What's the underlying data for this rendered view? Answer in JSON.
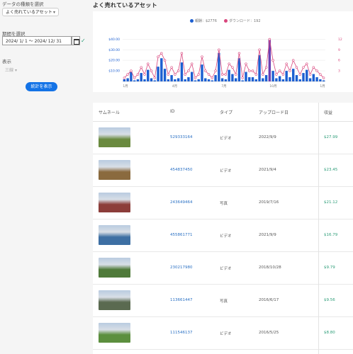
{
  "sidebar": {
    "data_type_label": "データの種類を選択",
    "data_type_value": "よく売れているアセット",
    "period_label": "期間を選択",
    "date_range": "2024/ 1/ 1 ～ 2024/ 12/ 31",
    "display_label": "表示",
    "display_value": "三線",
    "stats_button": "統計を表示"
  },
  "page_title": "よく売れているアセット",
  "chart_data": {
    "type": "bar+line",
    "legend": [
      {
        "name": "報酬：$2776",
        "color": "#1c5fd1"
      },
      {
        "name": "ダウンロード：192",
        "color": "#d9467d"
      }
    ],
    "y_left_ticks": [
      "$40.00",
      "$30.00",
      "$20.00",
      "$10.00"
    ],
    "y_right_ticks": [
      "12",
      "9",
      "6",
      "3"
    ],
    "x_ticks": [
      "1月",
      "4月",
      "7月",
      "10月",
      "1月"
    ],
    "earnings": [
      2,
      3,
      9,
      1,
      2,
      8,
      2,
      11,
      3,
      1,
      14,
      22,
      12,
      2,
      6,
      2,
      3,
      18,
      2,
      4,
      9,
      1,
      2,
      16,
      3,
      2,
      1,
      6,
      27,
      3,
      2,
      11,
      7,
      3,
      22,
      1,
      9,
      4,
      4,
      2,
      25,
      3,
      6,
      40,
      10,
      3,
      5,
      2,
      10,
      4,
      12,
      6,
      2,
      8,
      11,
      3,
      7,
      4,
      2,
      1
    ],
    "downloads": [
      1,
      2,
      3,
      1,
      2,
      4,
      2,
      5,
      3,
      1,
      7,
      8,
      6,
      2,
      4,
      2,
      3,
      8,
      2,
      3,
      5,
      1,
      2,
      7,
      3,
      2,
      1,
      3,
      9,
      2,
      2,
      5,
      4,
      2,
      8,
      1,
      5,
      3,
      3,
      2,
      9,
      2,
      4,
      12,
      6,
      2,
      3,
      2,
      5,
      3,
      6,
      4,
      2,
      4,
      5,
      2,
      4,
      3,
      2,
      1
    ],
    "ylim_left": [
      0,
      45
    ],
    "ylim_right": [
      0,
      13.5
    ]
  },
  "table": {
    "columns": [
      "サムネール",
      "ID",
      "タイプ",
      "アップロード日",
      "収益"
    ],
    "rows": [
      {
        "id": "529333164",
        "type": "ビデオ",
        "date": "2022/9/9",
        "earning": "$27.99",
        "thumb_color": "#6a8a3f"
      },
      {
        "id": "454837450",
        "type": "ビデオ",
        "date": "2021/9/4",
        "earning": "$23.45",
        "thumb_color": "#8a6a3e"
      },
      {
        "id": "243649464",
        "type": "写真",
        "date": "2019/7/16",
        "earning": "$21.12",
        "thumb_color": "#8c3d3a"
      },
      {
        "id": "455861771",
        "type": "ビデオ",
        "date": "2021/9/9",
        "earning": "$16.79",
        "thumb_color": "#3d6fa3"
      },
      {
        "id": "230217980",
        "type": "ビデオ",
        "date": "2018/10/28",
        "earning": "$9.79",
        "thumb_color": "#4f7a3a"
      },
      {
        "id": "113661447",
        "type": "写真",
        "date": "2016/6/17",
        "earning": "$9.56",
        "thumb_color": "#5a6a50"
      },
      {
        "id": "111546137",
        "type": "ビデオ",
        "date": "2016/5/25",
        "earning": "$8.80",
        "thumb_color": "#5c8f3e"
      }
    ]
  }
}
